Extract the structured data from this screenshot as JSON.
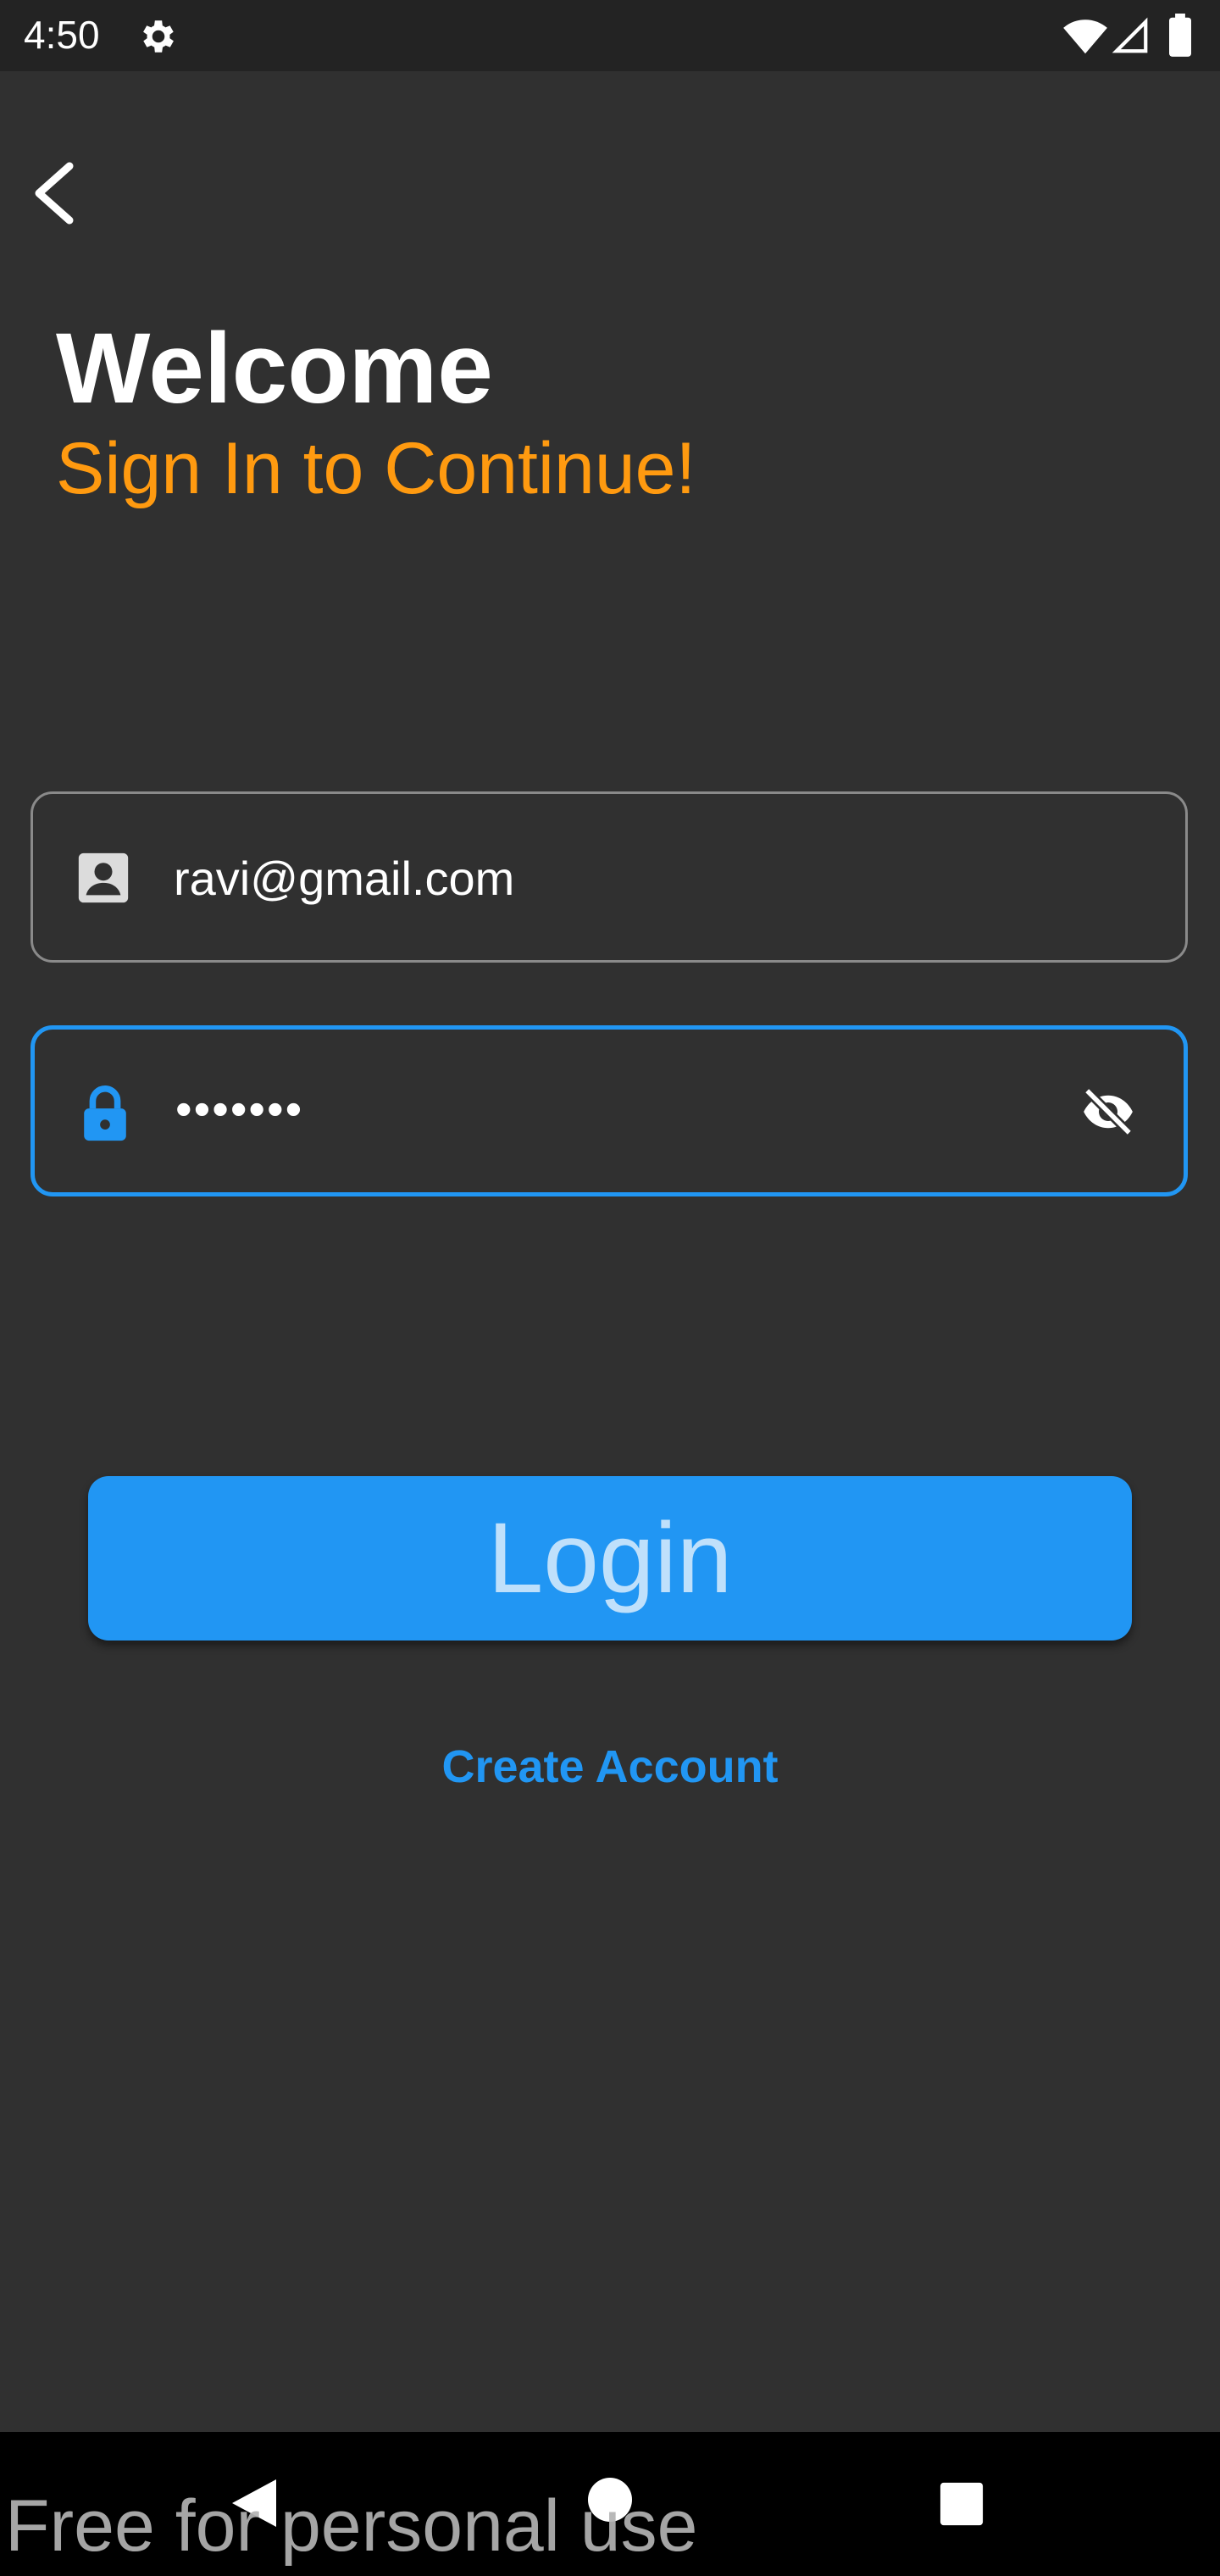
{
  "status_bar": {
    "time": "4:50",
    "icons": [
      "gear-icon",
      "wifi-icon",
      "signal-icon",
      "battery-icon"
    ]
  },
  "header": {
    "back_icon": "arrow-back-icon",
    "title": "Welcome",
    "subtitle": "Sign In to Continue!"
  },
  "form": {
    "email": {
      "icon": "person-badge-icon",
      "value": "ravi@gmail.com"
    },
    "password": {
      "icon": "lock-icon",
      "value": "•••••••",
      "toggle_icon": "eye-off-icon"
    }
  },
  "actions": {
    "login_label": "Login",
    "create_account_label": "Create Account"
  },
  "nav_bar": {
    "icons": [
      "nav-back-icon",
      "nav-home-icon",
      "nav-recents-icon"
    ]
  },
  "watermark": "Free for personal use",
  "colors": {
    "background": "#303030",
    "accent_orange": "#ff9a10",
    "primary_blue": "#2196f3",
    "button_text": "#bfe0fb"
  }
}
